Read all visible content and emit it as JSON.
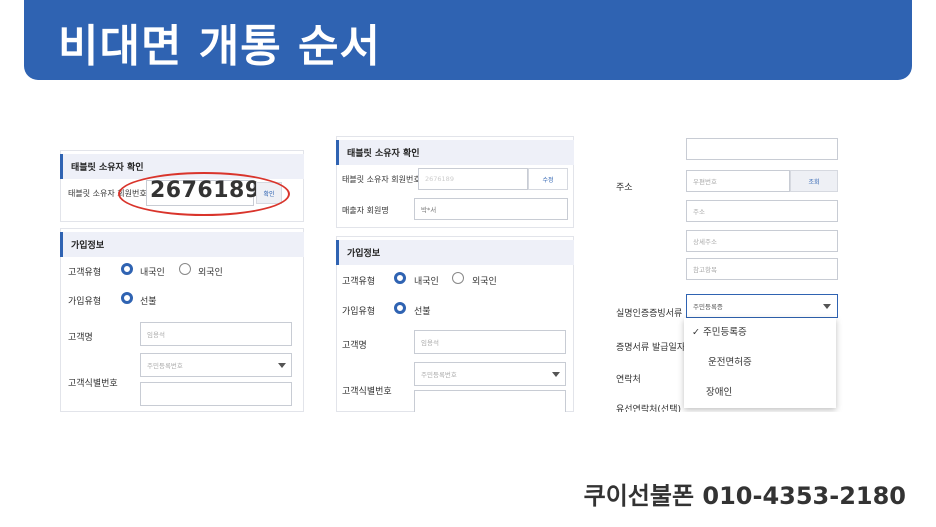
{
  "header": {
    "title": "비대면 개통 순서"
  },
  "panel1": {
    "tablet_section": "태블릿 소유자 확인",
    "tablet_label": "태블릿 소유자 회원번호",
    "member_number": "2676189",
    "confirm_btn": "확인",
    "join_section": "가입정보",
    "customer_type": "고객유형",
    "domestic": "내국인",
    "foreign": "외국인",
    "join_type": "가입유형",
    "prepaid": "선불",
    "customer_name": "고객명",
    "name_value": "임용석",
    "id_label": "고객식별번호",
    "id_select": "주민등록번호"
  },
  "panel2": {
    "tablet_section": "태블릿 소유자 확인",
    "tablet_label": "태블릿 소유자 회원번호",
    "member_value": "2676189",
    "modify_btn": "수정",
    "seller_label": "매출자 회원명",
    "seller_value": "박*서",
    "join_section": "가입정보",
    "customer_type": "고객유형",
    "domestic": "내국인",
    "foreign": "외국인",
    "join_type": "가입유형",
    "prepaid": "선불",
    "customer_name": "고객명",
    "name_value": "임용석",
    "id_label": "고객식별번호",
    "id_select": "주민등록번호"
  },
  "panel3": {
    "address_label": "주소",
    "zip_placeholder": "우편번호",
    "search_btn": "조회",
    "addr_placeholder": "주소",
    "detail_placeholder": "상세주소",
    "ref_placeholder": "참고항목",
    "id_doc_label": "실명인증증빙서류",
    "id_doc_select": "주민등록증",
    "issue_date_label": "증명서류 발급일자",
    "contact_label": "연락처",
    "landline_label": "유선연락처(선택)",
    "options": [
      "✓ 주민등록증",
      "운전면허증",
      "장애인"
    ]
  },
  "footer": {
    "text": "쿠이선불폰 010-4353-2180"
  }
}
